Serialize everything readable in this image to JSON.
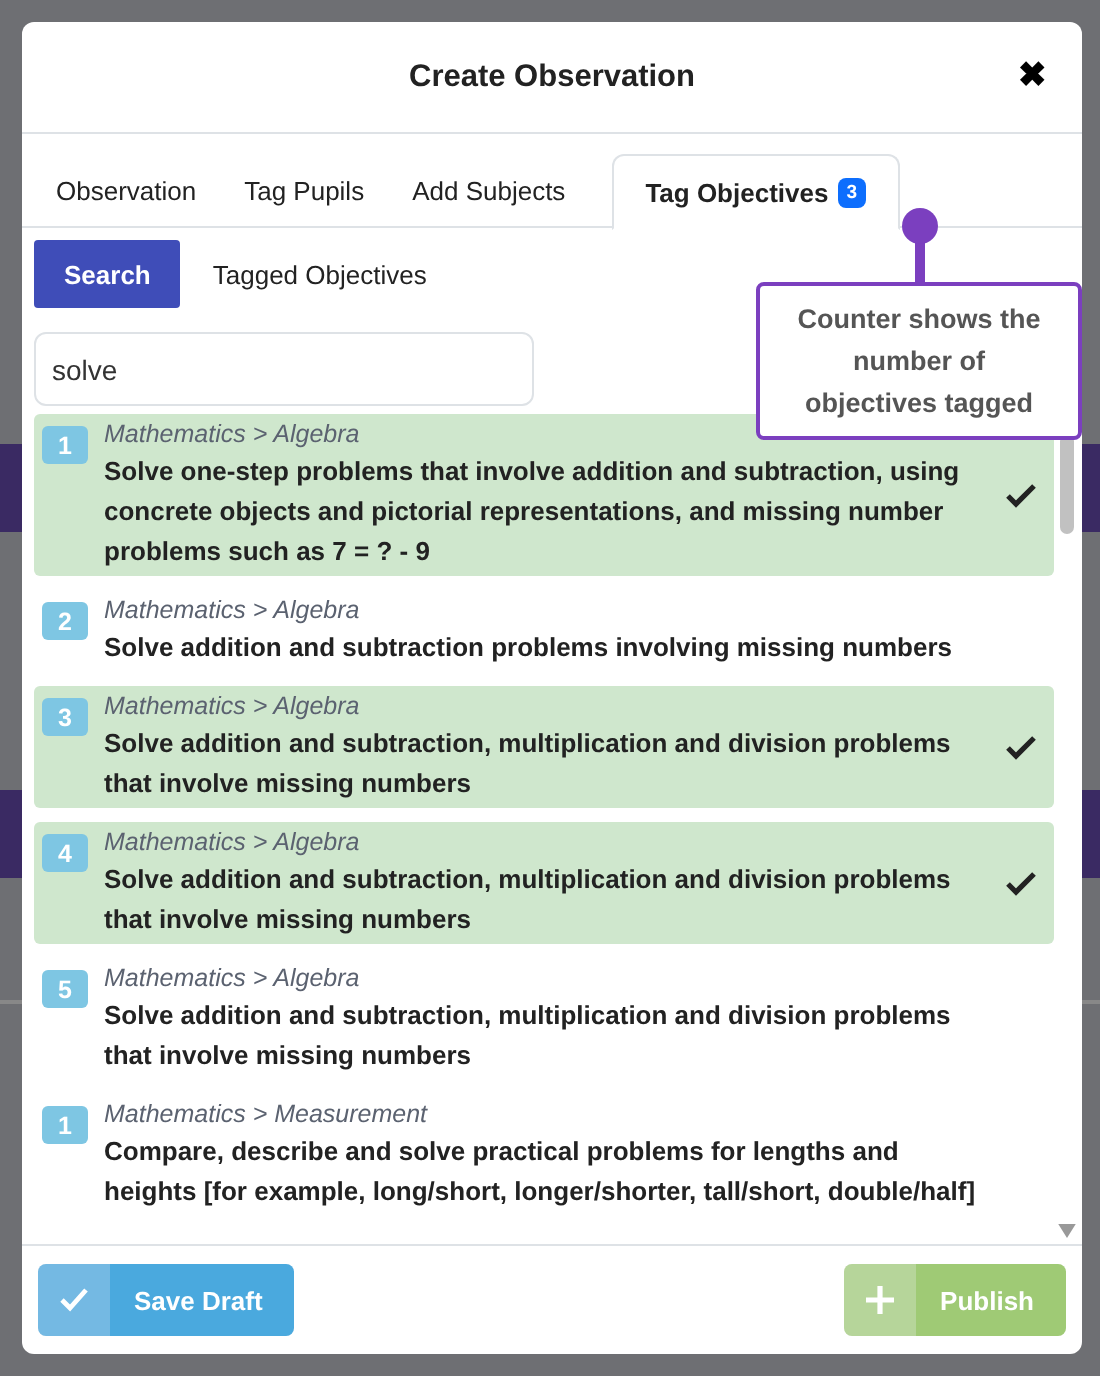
{
  "dialog": {
    "title": "Create Observation",
    "close": "✖"
  },
  "tabs": [
    {
      "label": "Observation",
      "selected": false
    },
    {
      "label": "Tag Pupils",
      "selected": false
    },
    {
      "label": "Add Subjects",
      "selected": false
    },
    {
      "label": "Tag Objectives",
      "selected": true,
      "badge": "3"
    }
  ],
  "subtabs": [
    {
      "label": "Search",
      "selected": true
    },
    {
      "label": "Tagged Objectives",
      "selected": false
    }
  ],
  "search": {
    "value": "solve"
  },
  "callout": {
    "text": "Counter shows the number of objectives tagged"
  },
  "objectives": [
    {
      "number": "1",
      "path": "Mathematics > Algebra",
      "text": "Solve one-step problems that involve addition and subtraction, using concrete objects and pictorial representations, and missing number problems such as 7 = ? - 9",
      "selected": true
    },
    {
      "number": "2",
      "path": "Mathematics > Algebra",
      "text": "Solve addition and subtraction problems involving missing numbers",
      "selected": false
    },
    {
      "number": "3",
      "path": "Mathematics > Algebra",
      "text": "Solve addition and subtraction, multiplication and division problems that involve missing numbers",
      "selected": true
    },
    {
      "number": "4",
      "path": "Mathematics > Algebra",
      "text": "Solve addition and subtraction, multiplication and division problems that involve missing numbers",
      "selected": true
    },
    {
      "number": "5",
      "path": "Mathematics > Algebra",
      "text": "Solve addition and subtraction, multiplication and division problems that involve missing numbers",
      "selected": false
    },
    {
      "number": "1",
      "path": "Mathematics > Measurement",
      "text": "Compare, describe and solve practical problems for lengths and heights [for example, long/short, longer/shorter, tall/short, double/half]",
      "selected": false
    }
  ],
  "footer": {
    "save": {
      "label": "Save Draft",
      "disabled": false
    },
    "publish": {
      "label": "Publish",
      "disabled": true
    }
  }
}
